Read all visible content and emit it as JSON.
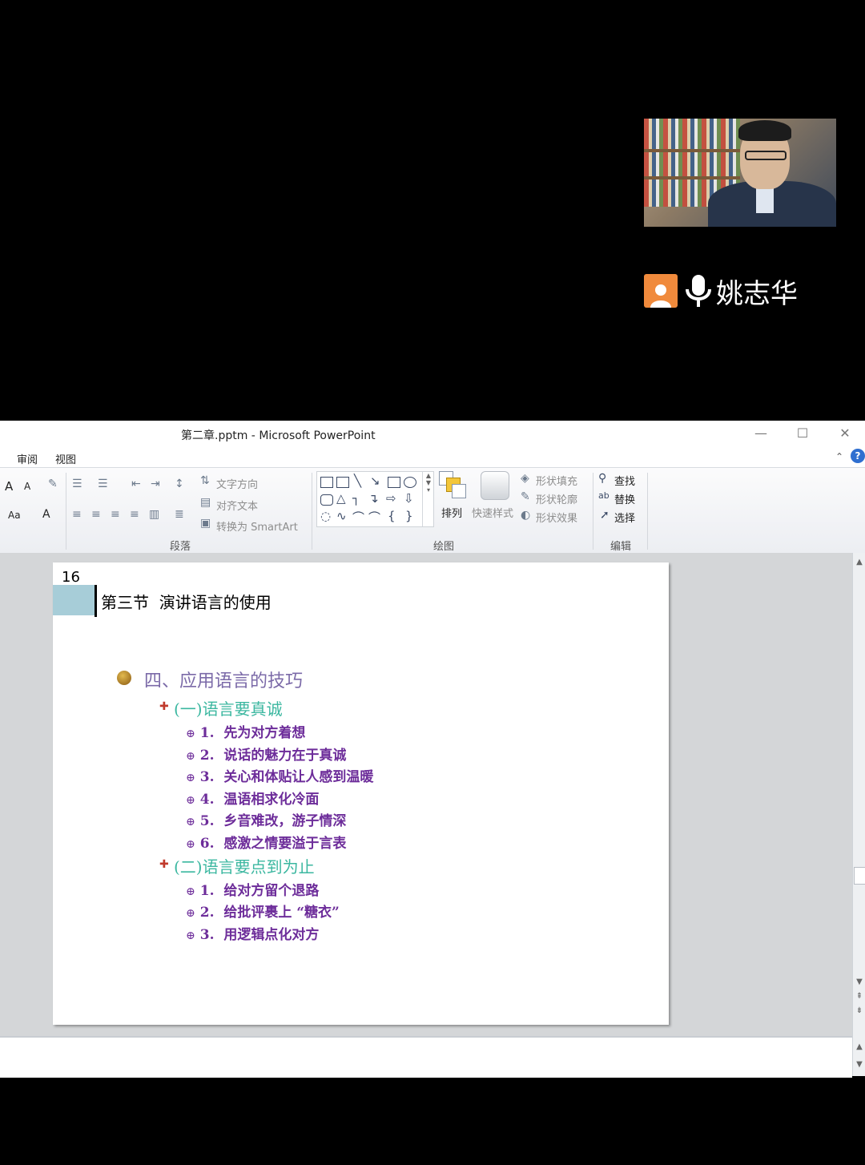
{
  "video": {
    "speaker_name": "姚志华",
    "avatar_icon": "person-icon",
    "mic_icon": "microphone-icon",
    "accent": "#f08a3c"
  },
  "window": {
    "title_file": "第二章.pptm",
    "title_sep": " - ",
    "title_app": "Microsoft PowerPoint",
    "min_glyph": "—",
    "max_glyph": "☐",
    "close_glyph": "✕"
  },
  "menu": {
    "review": "审阅",
    "view": "视图"
  },
  "ribbon": {
    "font_grow": "A",
    "font_shrink": "A",
    "change_case": "Aa",
    "font_color": "A",
    "text_direction": "文字方向",
    "align_text": "对齐文本",
    "convert_smartart": "转换为 SmartArt",
    "paragraph_group": "段落",
    "arrange": "排列",
    "quick_styles": "快速样式",
    "shape_fill": "形状填充",
    "shape_outline": "形状轮廓",
    "shape_effects": "形状效果",
    "drawing_group": "绘图",
    "find": "查找",
    "replace": "替换",
    "select": "选择",
    "editing_group": "编辑"
  },
  "slide": {
    "number": "16",
    "title": "第三节  演讲语言的使用",
    "heading": "四、应用语言的技巧",
    "sections": [
      {
        "label": "(一)语言要真诚",
        "items": [
          "1.  先为对方着想",
          "2.  说话的魅力在于真诚",
          "3.  关心和体贴让人感到温暖",
          "4.  温语相求化冷面",
          "5.  乡音难改，游子情深",
          "6.  感激之情要溢于言表"
        ]
      },
      {
        "label": "(二)语言要点到为止",
        "items": [
          "1.  给对方留个退路",
          "2.  给批评裹上 “糖衣”",
          "3.  用逻辑点化对方"
        ]
      }
    ]
  }
}
